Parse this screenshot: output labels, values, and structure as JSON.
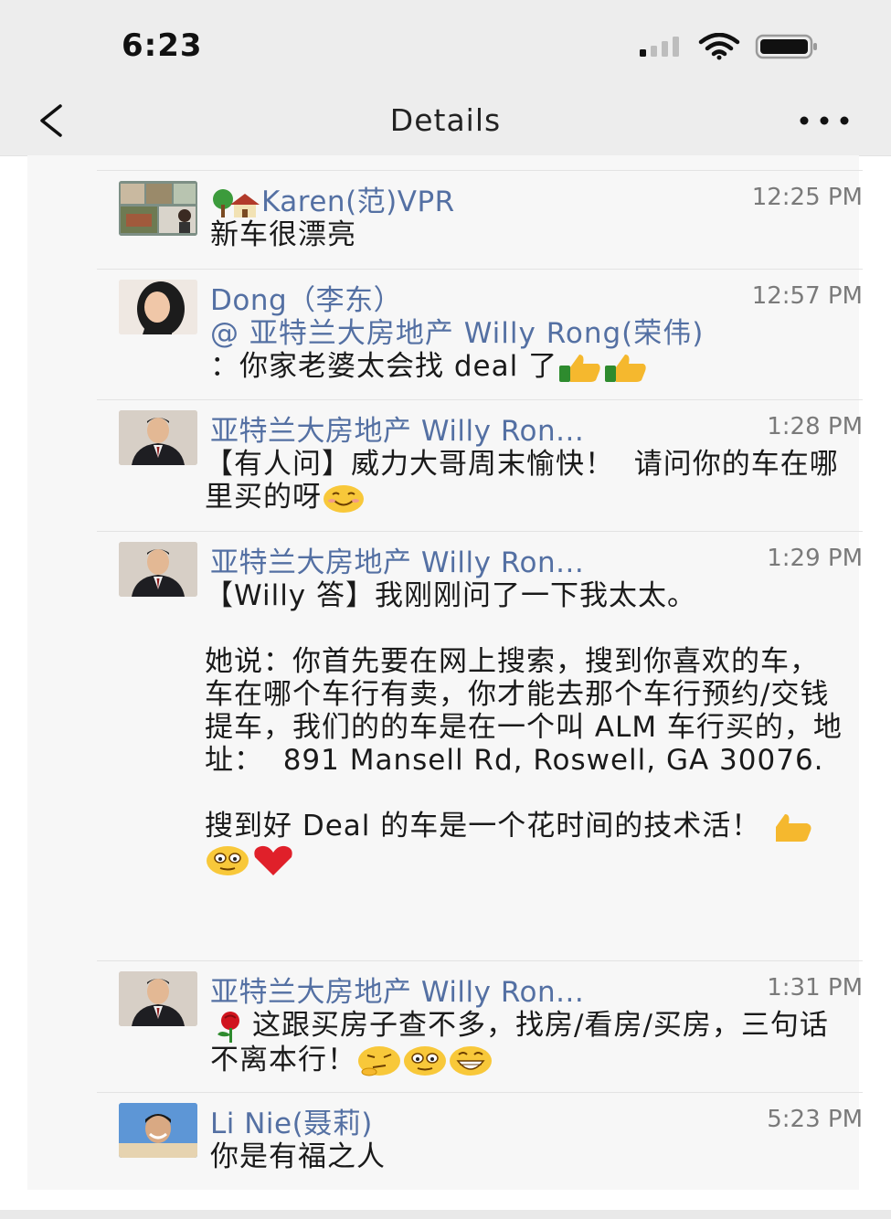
{
  "status": {
    "time": "6:23"
  },
  "header": {
    "title": "Details"
  },
  "messages": [
    {
      "name": "Karen(范)VPR",
      "time": "12:25 PM",
      "text": "新车很漂亮"
    },
    {
      "name": "Dong（李东）",
      "time": "12:57 PM",
      "mention": "@ 亚特兰大房地产 Willy Rong(荣伟)",
      "text": "：你家老婆太会找 deal 了"
    },
    {
      "name": "亚特兰大房地产 Willy Ron...",
      "time": "1:28 PM",
      "text": "【有人问】威力大哥周末愉快！  请问你的车在哪里买的呀"
    },
    {
      "name": "亚特兰大房地产 Willy Ron...",
      "time": "1:29 PM",
      "text": "【Willy 答】我刚刚问了一下我太太。\n\n她说：你首先要在网上搜索，搜到你喜欢的车，车在哪个车行有卖，你才能去那个车行预约/交钱提车，我们的的车是在一个叫 ALM 车行买的，地址：  891 Mansell Rd, Roswell, GA 30076.\n\n搜到好 Deal 的车是一个花时间的技术活！"
    },
    {
      "name": "亚特兰大房地产 Willy Ron...",
      "time": "1:31 PM",
      "text": "这跟买房子查不多，找房/看房/买房，三句话不离本行！"
    },
    {
      "name": "Li Nie(聂莉)",
      "time": "5:23 PM",
      "text": "你是有福之人"
    }
  ],
  "icons": [
    "back-chevron-icon",
    "more-dots-icon",
    "signal-icon",
    "wifi-icon",
    "battery-icon",
    "house-tree-icon",
    "thumbs-up-icon",
    "smile-icon",
    "heart-icon",
    "rose-icon",
    "thinking-icon",
    "grin-icon"
  ],
  "colors": {
    "name": "#5470a3",
    "timestamp": "#7a7a7a",
    "bar": "#ededed",
    "card": "#f7f7f7"
  }
}
